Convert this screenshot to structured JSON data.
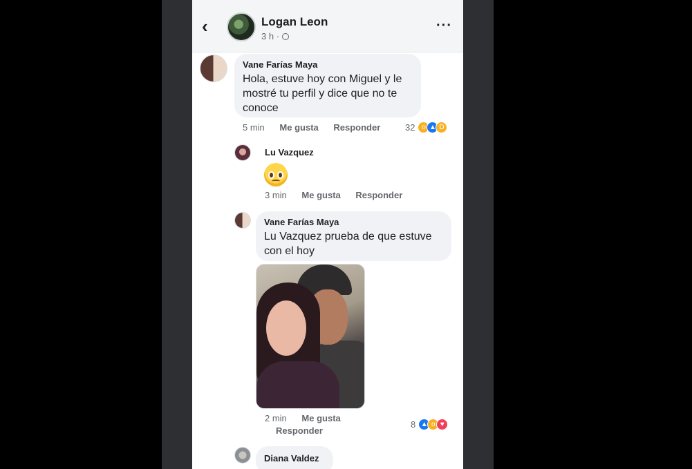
{
  "header": {
    "back_icon": "chevron-left-icon",
    "name": "Logan Leon",
    "time": "3 h ·",
    "more_icon": "more-horizontal-icon"
  },
  "comments": [
    {
      "author": "Vane Farías Maya",
      "text": "Hola, estuve hoy con Miguel y le mostré tu perfil y dice que no te conoce",
      "time": "5 min",
      "like": "Me gusta",
      "reply": "Responder",
      "reaction_count": "32",
      "reactions": [
        "wow-icon",
        "like-icon",
        "haha-icon"
      ]
    },
    {
      "author": "Lu Vazquez",
      "emoji": "pleading-face-icon",
      "time": "3 min",
      "like": "Me gusta",
      "reply": "Responder"
    },
    {
      "author": "Vane Farías Maya",
      "text": "Lu Vazquez prueba de que estuve con el hoy",
      "has_photo": true,
      "time": "2 min",
      "like": "Me gusta",
      "reply": "Responder",
      "reaction_count": "8",
      "reactions": [
        "like-icon",
        "wow-icon",
        "love-icon"
      ]
    },
    {
      "author": "Diana Valdez"
    }
  ],
  "colors": {
    "header_bg": "#f4f5f6",
    "bubble_bg": "#f0f2f5",
    "like_blue": "#1877f2",
    "love_red": "#f33e58",
    "wow_yellow": "#f7b125"
  }
}
